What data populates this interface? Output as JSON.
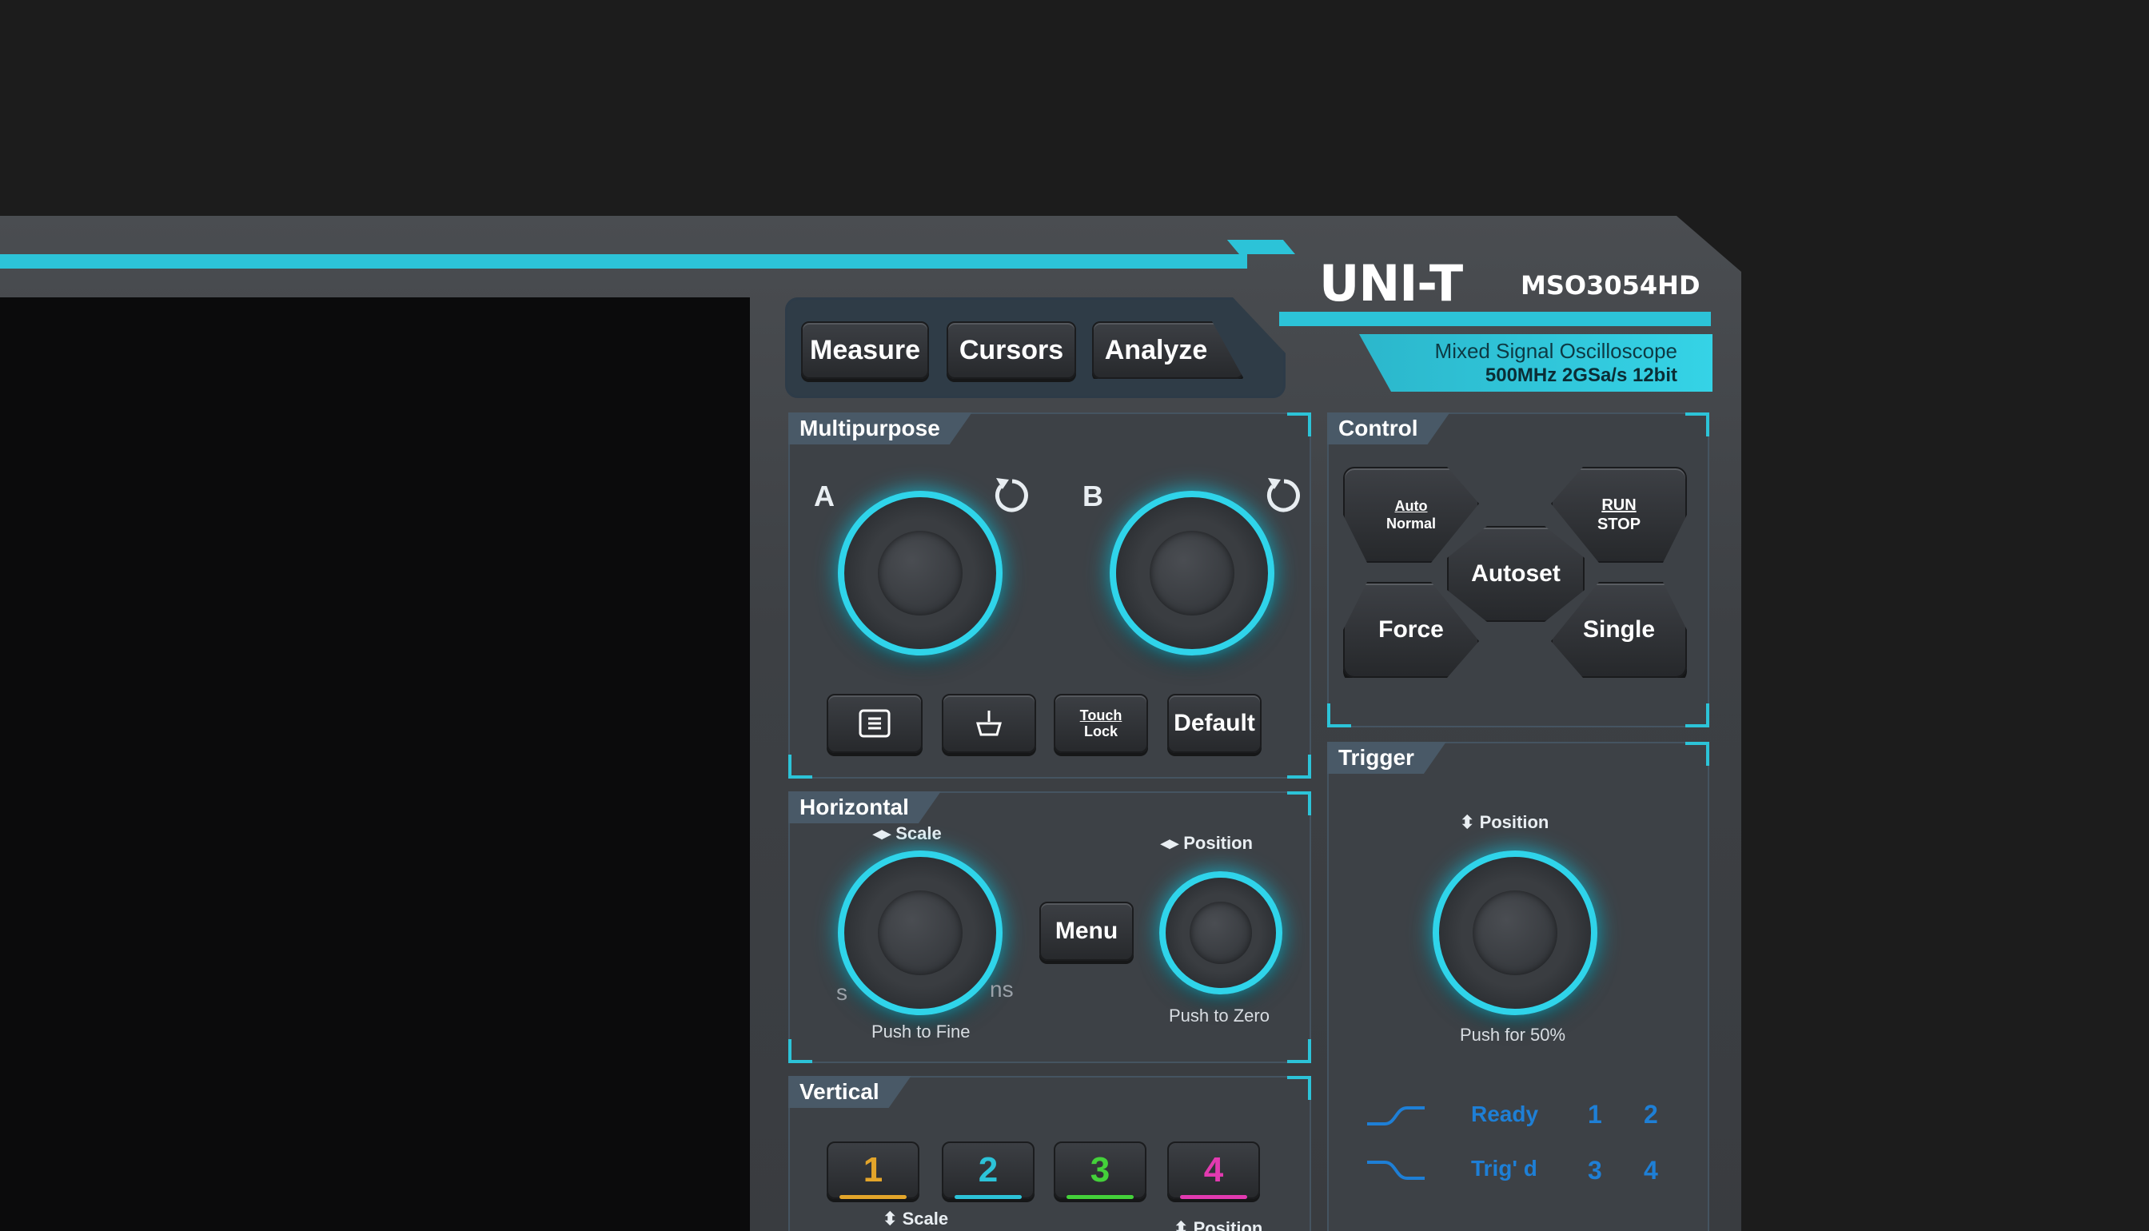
{
  "brand": {
    "logo": "UNI-T",
    "model": "MSO3054HD",
    "subtitle": "Mixed Signal Oscilloscope",
    "spec": "500MHz  2GSa/s 12bit"
  },
  "top_buttons": {
    "measure": "Measure",
    "cursors": "Cursors",
    "analyze": "Analyze"
  },
  "multipurpose": {
    "title": "Multipurpose",
    "knob_a": "A",
    "knob_b": "B",
    "buttons": {
      "touch_top": "Touch",
      "touch_bottom": "Lock",
      "default": "Default"
    }
  },
  "control": {
    "title": "Control",
    "auto_top": "Auto",
    "auto_bottom": "Normal",
    "run_top": "RUN",
    "run_bottom": "STOP",
    "autoset": "Autoset",
    "force": "Force",
    "single": "Single"
  },
  "horizontal": {
    "title": "Horizontal",
    "scale_label": "Scale",
    "position_label": "Position",
    "menu": "Menu",
    "push_fine": "Push to Fine",
    "push_zero": "Push to Zero",
    "s_label": "s",
    "ns_label": "ns"
  },
  "trigger": {
    "title": "Trigger",
    "position_label": "Position",
    "push_50": "Push for 50%",
    "ready": "Ready",
    "trigd": "Trig' d",
    "channels": [
      "1",
      "2",
      "3",
      "4"
    ]
  },
  "vertical": {
    "title": "Vertical",
    "channels": [
      {
        "label": "1",
        "color": "#e3a52a"
      },
      {
        "label": "2",
        "color": "#2cc3d8"
      },
      {
        "label": "3",
        "color": "#44d13a"
      },
      {
        "label": "4",
        "color": "#e23ab0"
      }
    ],
    "scale_label": "Scale",
    "position_label": "Position"
  },
  "colors": {
    "accent": "#2cc3d8",
    "status_blue": "#1e7fd6"
  },
  "icons": [
    "rotate-icon",
    "screenshot-icon",
    "clear-icon",
    "updown-arrow-icon",
    "leftright-arrow-icon",
    "rise-edge-icon",
    "fall-edge-icon"
  ]
}
